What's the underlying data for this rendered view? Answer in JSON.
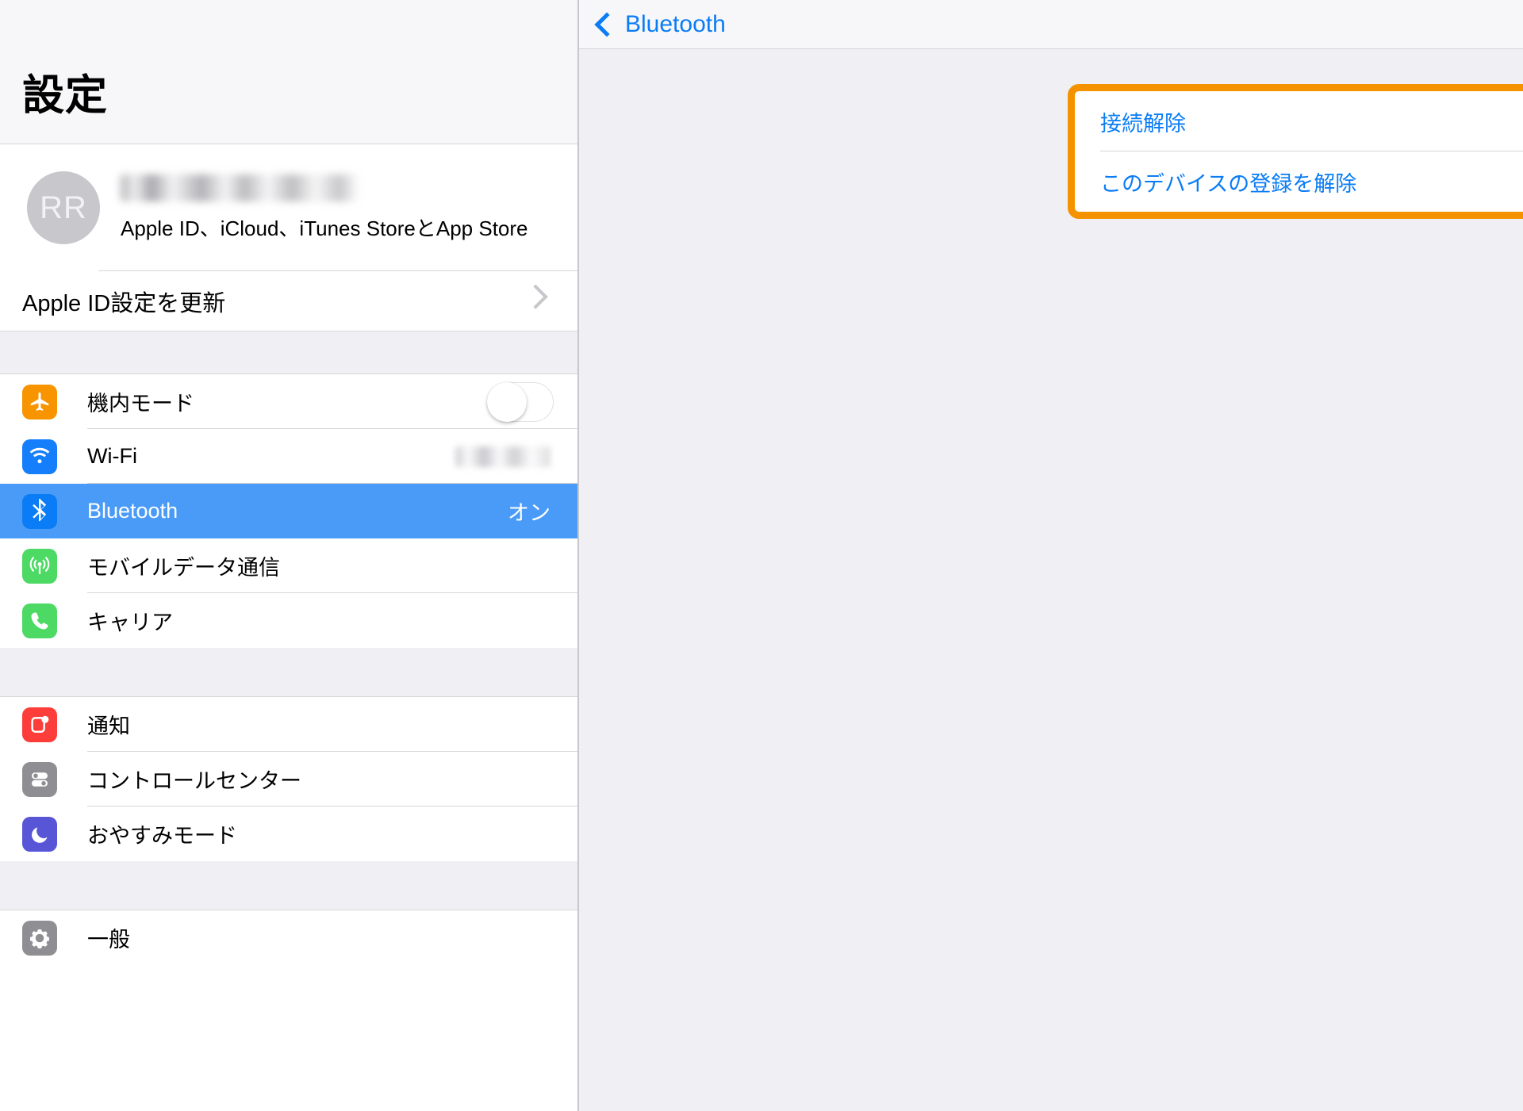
{
  "sidebar": {
    "title": "設定",
    "apple_id": {
      "avatar_initials": "RR",
      "name_redacted": "",
      "subtitle": "Apple ID、iCloud、iTunes StoreとApp Store",
      "update_label": "Apple ID設定を更新",
      "chevron": "chevron-right-icon"
    },
    "groups": [
      {
        "items": [
          {
            "label": "機内モード",
            "icon": "airplane-icon",
            "icon_color": "#F79400",
            "control": "toggle",
            "toggle_on": false
          },
          {
            "label": "Wi-Fi",
            "icon": "wifi-icon",
            "icon_color": "#147EFB",
            "control": "value_blurred",
            "value": ""
          },
          {
            "label": "Bluetooth",
            "icon": "bluetooth-icon",
            "icon_color": "#0A7CF5",
            "control": "value",
            "value": "オン",
            "selected": true
          },
          {
            "label": "モバイルデータ通信",
            "icon": "cellular-icon",
            "icon_color": "#4CD964",
            "control": "none"
          },
          {
            "label": "キャリア",
            "icon": "phone-icon",
            "icon_color": "#4CD964",
            "control": "none"
          }
        ]
      },
      {
        "items": [
          {
            "label": "通知",
            "icon": "notifications-icon",
            "icon_color": "#FC3D39",
            "control": "none"
          },
          {
            "label": "コントロールセンター",
            "icon": "control-center-icon",
            "icon_color": "#8E8E93",
            "control": "none"
          },
          {
            "label": "おやすみモード",
            "icon": "moon-icon",
            "icon_color": "#5856D6",
            "control": "none"
          }
        ]
      },
      {
        "items": [
          {
            "label": "一般",
            "icon": "gear-icon",
            "icon_color": "#8E8E93",
            "control": "none"
          }
        ]
      }
    ]
  },
  "detail": {
    "back_label": "Bluetooth",
    "back_icon": "chevron-left-icon",
    "highlight_color": "#F59200",
    "actions": [
      {
        "label": "接続解除"
      },
      {
        "label": "このデバイスの登録を解除"
      }
    ]
  }
}
